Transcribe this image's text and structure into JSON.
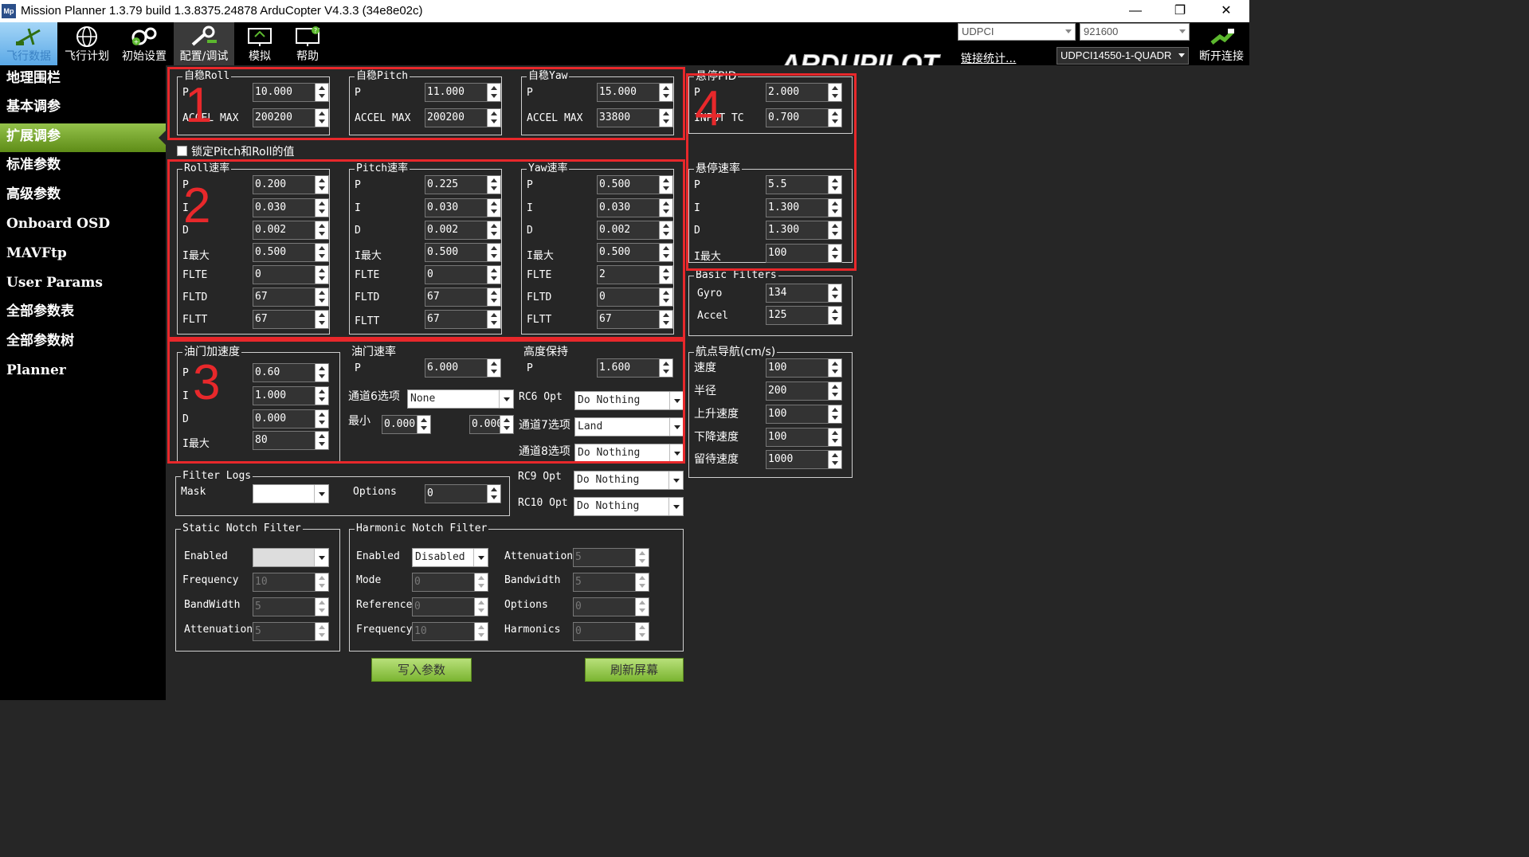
{
  "window": {
    "title": "Mission Planner 1.3.79 build 1.3.8375.24878 ArduCopter V4.3.3 (34e8e02c)",
    "logo_text": "Mp",
    "minimize": "—",
    "restore": "❐",
    "close": "✕"
  },
  "toolbar": {
    "items": [
      {
        "label": "飞行数据",
        "icon": "flight-data-icon"
      },
      {
        "label": "飞行计划",
        "icon": "flight-plan-globe-icon"
      },
      {
        "label": "初始设置",
        "icon": "initial-setup-gears-icon"
      },
      {
        "label": "配置/调试",
        "icon": "config-tuning-wrench-icon"
      },
      {
        "label": "模拟",
        "icon": "simulation-monitor-icon"
      },
      {
        "label": "帮助",
        "icon": "help-monitor-icon"
      }
    ],
    "brand": "ARDUPILOT",
    "port": "UDPCI",
    "baud": "921600",
    "link_stats": "链接统计...",
    "vehicle": "UDPCI14550-1-QUADR",
    "disconnect": "断开连接"
  },
  "sidebar": {
    "items": [
      "地理围栏",
      "基本调参",
      "扩展调参",
      "标准参数",
      "高级参数",
      "Onboard OSD",
      "MAVFtp",
      "User Params",
      "全部参数表",
      "全部参数树",
      "Planner"
    ],
    "active_index": 2
  },
  "stab": {
    "roll": {
      "title": "自稳Roll",
      "p_label": "P",
      "accel_label": "ACCEL MAX",
      "p": "10.000",
      "accel": "200200"
    },
    "pitch": {
      "title": "自稳Pitch",
      "p_label": "P",
      "accel_label": "ACCEL MAX",
      "p": "11.000",
      "accel": "200200"
    },
    "yaw": {
      "title": "自稳Yaw",
      "p_label": "P",
      "accel_label": "ACCEL MAX",
      "p": "15.000",
      "accel": "33800"
    }
  },
  "lock_pitch_roll": {
    "label": "锁定Pitch和Roll的值",
    "checked": false
  },
  "rate_labels": [
    "P",
    "I",
    "D",
    "I最大",
    "FLTE",
    "FLTD",
    "FLTT"
  ],
  "rates": {
    "roll": {
      "title": "Roll速率",
      "values": [
        "0.200",
        "0.030",
        "0.002",
        "0.500",
        "0",
        "67",
        "67"
      ]
    },
    "pitch": {
      "title": "Pitch速率",
      "values": [
        "0.225",
        "0.030",
        "0.002",
        "0.500",
        "0",
        "67",
        "67"
      ]
    },
    "yaw": {
      "title": "Yaw速率",
      "values": [
        "0.500",
        "0.030",
        "0.002",
        "0.500",
        "2",
        "0",
        "67"
      ]
    }
  },
  "throttle_accel": {
    "title": "油门加速度",
    "labels": [
      "P",
      "I",
      "D",
      "I最大"
    ],
    "values": [
      "0.60",
      "1.000",
      "0.000",
      "80"
    ]
  },
  "throttle_rate": {
    "title": "油门速率",
    "p_label": "P",
    "p": "6.000",
    "ch6_label": "通道6选项",
    "ch6_value": "None",
    "min_label": "最小",
    "min": "0.000",
    "max": "0.000"
  },
  "alt_hold": {
    "title": "高度保持",
    "p_label": "P",
    "p": "1.600",
    "rc6_label": "RC6 Opt",
    "rc6": "Do Nothing",
    "ch7_label": "通道7选项",
    "ch7": "Land",
    "ch8_label": "通道8选项",
    "ch8": "Do Nothing"
  },
  "rc_opts": {
    "rc9_label": "RC9 Opt",
    "rc9": "Do Nothing",
    "rc10_label": "RC10 Opt",
    "rc10": "Do Nothing"
  },
  "loiter_pid": {
    "title": "悬停PID",
    "p_label": "P",
    "p": "2.000",
    "tc_label": "INPUT TC",
    "tc": "0.700"
  },
  "loiter_rate": {
    "title": "悬停速率",
    "labels": [
      "P",
      "I",
      "D",
      "I最大"
    ],
    "values": [
      "5.5",
      "1.300",
      "1.300",
      "100"
    ]
  },
  "basic_filters": {
    "title": "Basic Filters",
    "gyro_label": "Gyro",
    "gyro": "134",
    "accel_label": "Accel",
    "accel": "125"
  },
  "waypoint_nav": {
    "title": "航点导航(cm/s)",
    "labels": [
      "速度",
      "半径",
      "上升速度",
      "下降速度",
      "留待速度"
    ],
    "values": [
      "100",
      "200",
      "100",
      "100",
      "1000"
    ]
  },
  "filter_logs": {
    "title": "Filter Logs",
    "mask_label": "Mask",
    "mask": "",
    "options_label": "Options",
    "options": "0"
  },
  "static_notch": {
    "title": "Static Notch Filter",
    "labels": [
      "Enabled",
      "Frequency",
      "BandWidth",
      "Attenuation"
    ],
    "enabled": "",
    "values": [
      "10",
      "5",
      "5"
    ]
  },
  "harmonic_notch": {
    "title": "Harmonic Notch Filter",
    "left_labels": [
      "Enabled",
      "Mode",
      "Reference",
      "Frequency"
    ],
    "enabled": "Disabled",
    "left_values": [
      "0",
      "0",
      "10"
    ],
    "right_labels": [
      "Attenuation",
      "Bandwidth",
      "Options",
      "Harmonics"
    ],
    "right_values": [
      "5",
      "5",
      "0",
      "0"
    ]
  },
  "buttons": {
    "write": "写入参数",
    "refresh": "刷新屏幕"
  },
  "annotations": {
    "box1": "1",
    "box2": "2",
    "box3": "3",
    "box4": "4",
    "color": "#e8282b"
  }
}
